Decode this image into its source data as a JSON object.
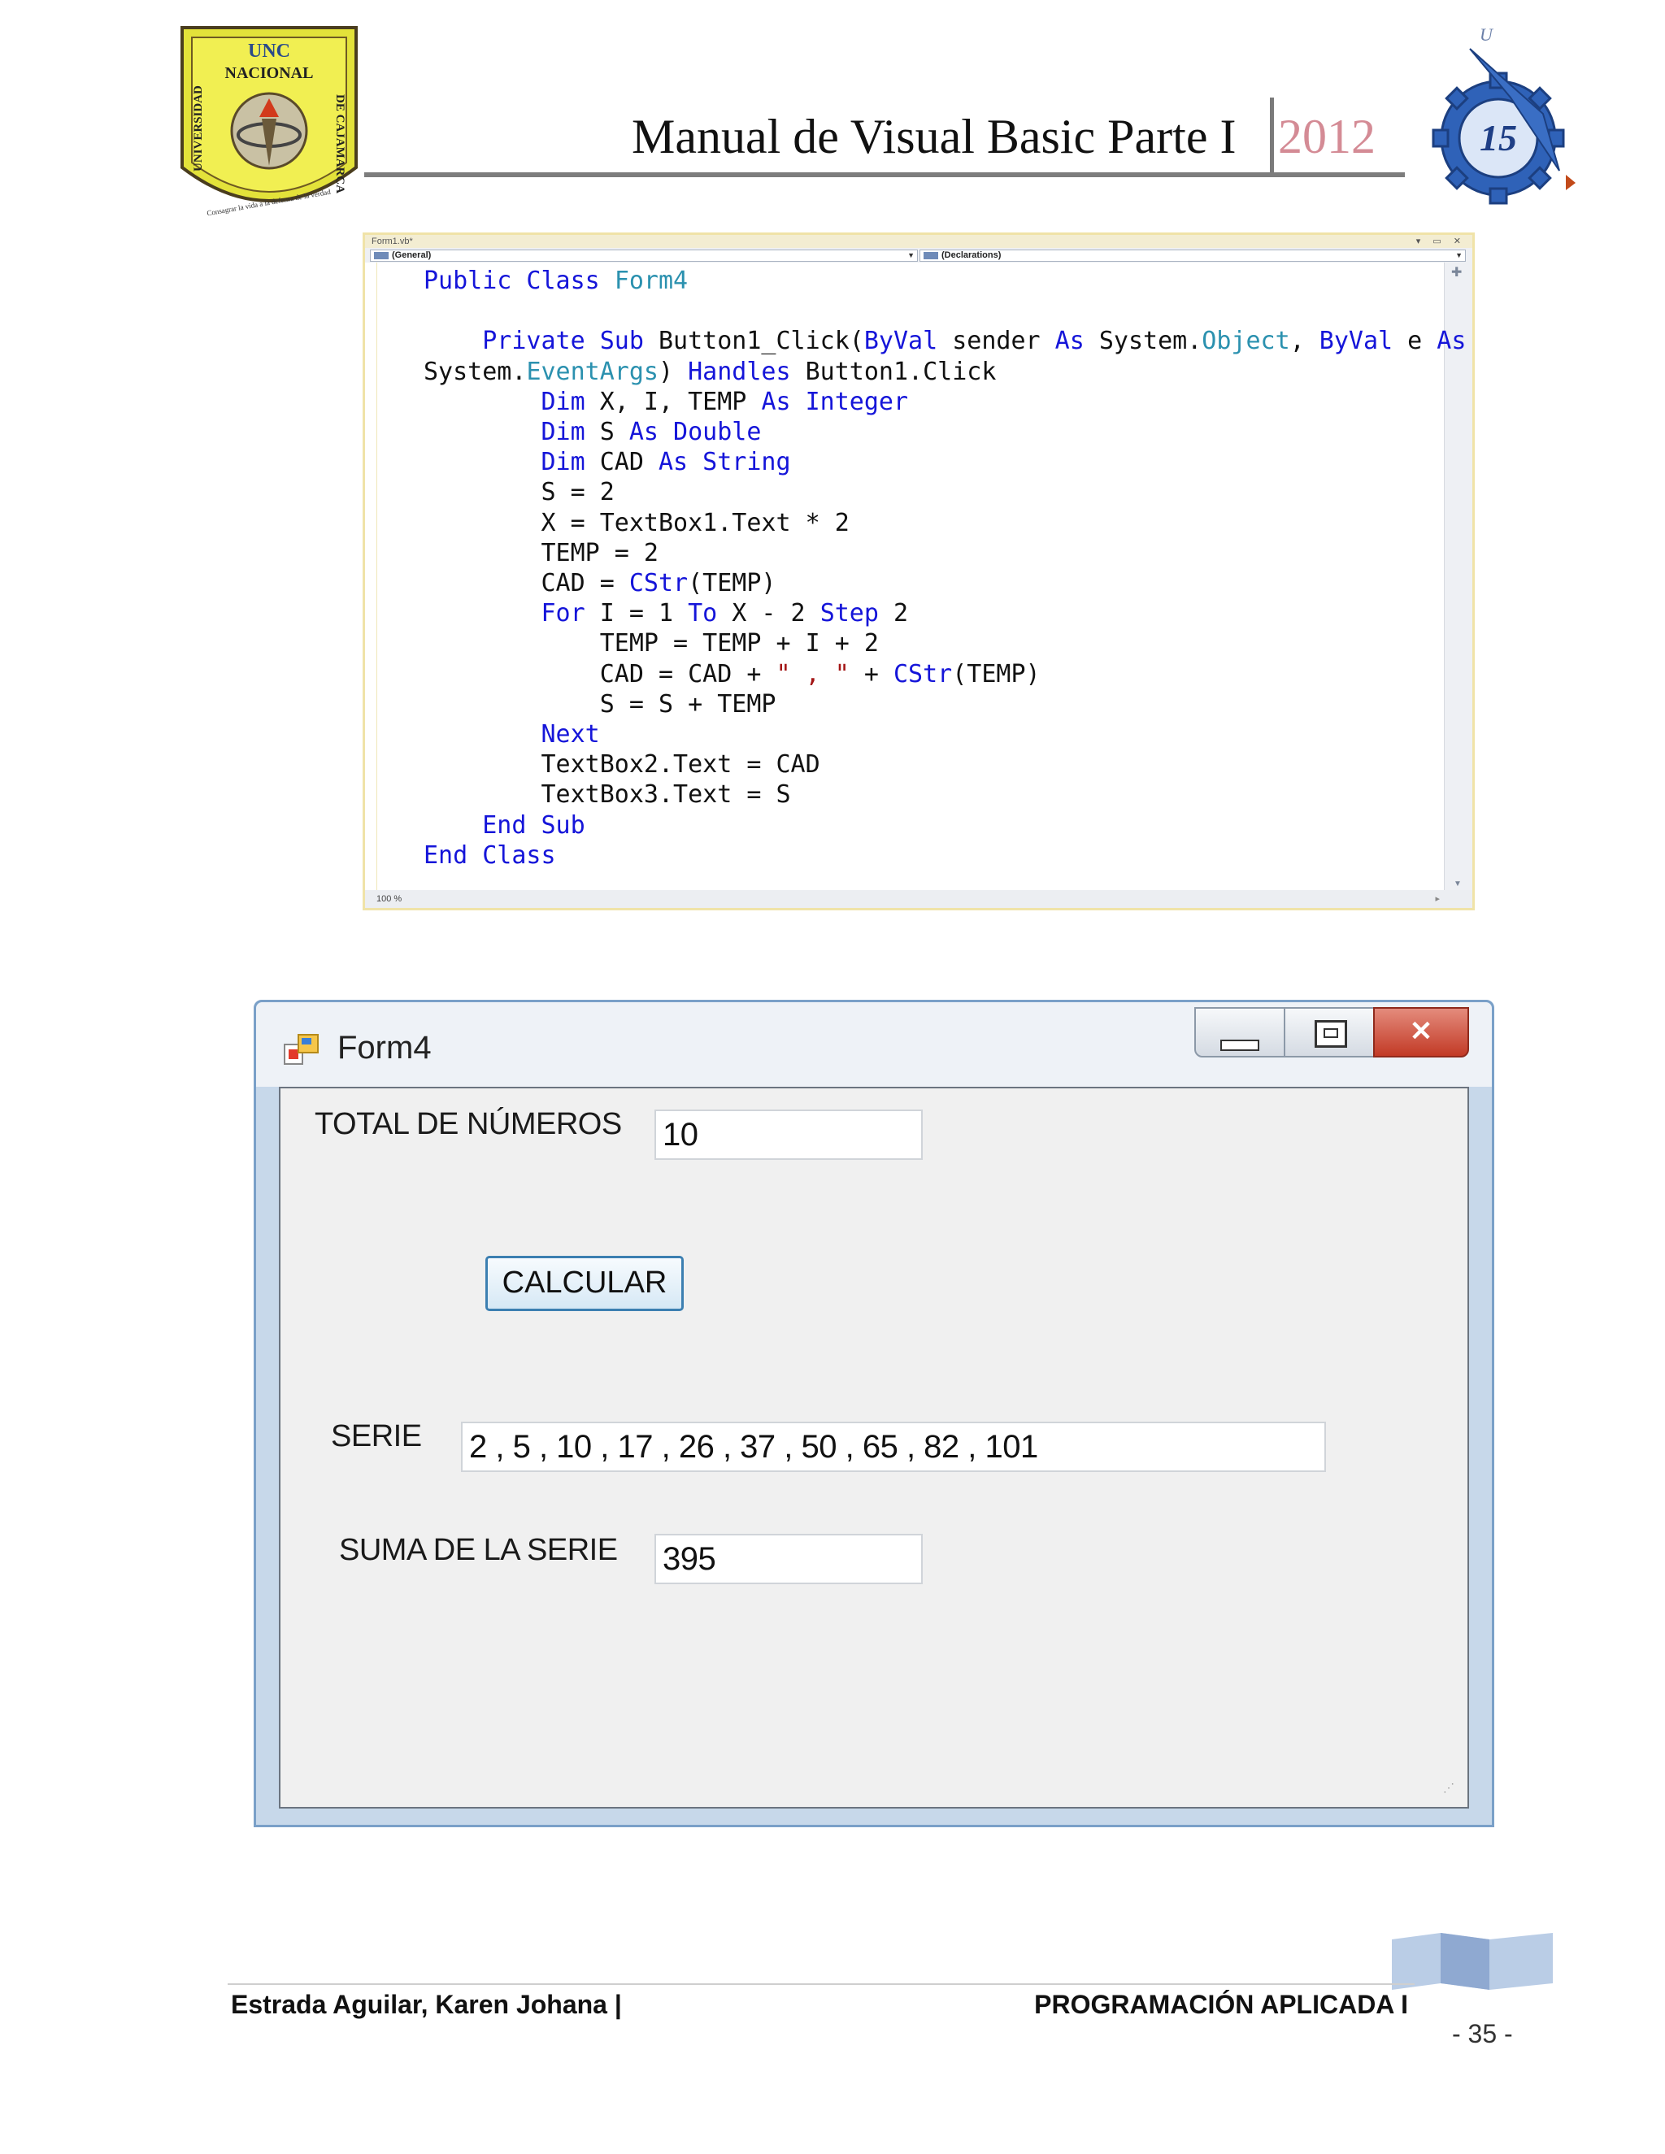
{
  "header": {
    "title": "Manual de Visual Basic Parte I",
    "year": "2012",
    "logo_left": {
      "acronym": "UNC",
      "top_text": "NACIONAL",
      "left_text": "UNIVERSIDAD",
      "right_text": "DE CAJAMARCA",
      "motto": "Consagrar la vida a la defensa de la verdad"
    },
    "logo_right": {
      "numeral": "15"
    }
  },
  "editor": {
    "file_tab": "Form1.vb*",
    "object_combo": "(General)",
    "member_combo": "(Declarations)",
    "zoom": "100 %",
    "code_lines": [
      [
        {
          "t": "Public Class ",
          "c": "kw"
        },
        {
          "t": "Form4",
          "c": "ty"
        }
      ],
      [],
      [
        {
          "t": "    Private Sub ",
          "c": "kw"
        },
        {
          "t": "Button1_Click(",
          "c": ""
        },
        {
          "t": "ByVal",
          "c": "kw"
        },
        {
          "t": " sender ",
          "c": ""
        },
        {
          "t": "As",
          "c": "kw"
        },
        {
          "t": " System.",
          "c": ""
        },
        {
          "t": "Object",
          "c": "ty"
        },
        {
          "t": ", ",
          "c": ""
        },
        {
          "t": "ByVal",
          "c": "kw"
        },
        {
          "t": " e ",
          "c": ""
        },
        {
          "t": "As",
          "c": "kw"
        }
      ],
      [
        {
          "t": "System.",
          "c": ""
        },
        {
          "t": "EventArgs",
          "c": "ty"
        },
        {
          "t": ") ",
          "c": ""
        },
        {
          "t": "Handles",
          "c": "kw"
        },
        {
          "t": " Button1.Click",
          "c": ""
        }
      ],
      [
        {
          "t": "        Dim",
          "c": "kw"
        },
        {
          "t": " X, I, TEMP ",
          "c": ""
        },
        {
          "t": "As Integer",
          "c": "kw"
        }
      ],
      [
        {
          "t": "        Dim",
          "c": "kw"
        },
        {
          "t": " S ",
          "c": ""
        },
        {
          "t": "As Double",
          "c": "kw"
        }
      ],
      [
        {
          "t": "        Dim",
          "c": "kw"
        },
        {
          "t": " CAD ",
          "c": ""
        },
        {
          "t": "As String",
          "c": "kw"
        }
      ],
      [
        {
          "t": "        S = 2",
          "c": ""
        }
      ],
      [
        {
          "t": "        X = TextBox1.Text * 2",
          "c": ""
        }
      ],
      [
        {
          "t": "        TEMP = 2",
          "c": ""
        }
      ],
      [
        {
          "t": "        CAD = ",
          "c": ""
        },
        {
          "t": "CStr",
          "c": "kw"
        },
        {
          "t": "(TEMP)",
          "c": ""
        }
      ],
      [
        {
          "t": "        For",
          "c": "kw"
        },
        {
          "t": " I = 1 ",
          "c": ""
        },
        {
          "t": "To",
          "c": "kw"
        },
        {
          "t": " X - 2 ",
          "c": ""
        },
        {
          "t": "Step",
          "c": "kw"
        },
        {
          "t": " 2",
          "c": ""
        }
      ],
      [
        {
          "t": "            TEMP = TEMP + I + 2",
          "c": ""
        }
      ],
      [
        {
          "t": "            CAD = CAD + ",
          "c": ""
        },
        {
          "t": "\" , \"",
          "c": "st"
        },
        {
          "t": " + ",
          "c": ""
        },
        {
          "t": "CStr",
          "c": "kw"
        },
        {
          "t": "(TEMP)",
          "c": ""
        }
      ],
      [
        {
          "t": "            S = S + TEMP",
          "c": ""
        }
      ],
      [
        {
          "t": "        Next",
          "c": "kw"
        }
      ],
      [
        {
          "t": "        TextBox2.Text = CAD",
          "c": ""
        }
      ],
      [
        {
          "t": "        TextBox3.Text = S",
          "c": ""
        }
      ],
      [
        {
          "t": "    End Sub",
          "c": "kw"
        }
      ],
      [
        {
          "t": "End Class",
          "c": "kw"
        }
      ]
    ]
  },
  "form": {
    "title": "Form4",
    "total_label": "TOTAL DE NÚMEROS",
    "total_value": "10",
    "calculate_button": "CALCULAR",
    "serie_label": "SERIE",
    "serie_value": "2 , 5 , 10 , 17 , 26 , 37 , 50 , 65 , 82 , 101",
    "suma_label": "SUMA DE LA SERIE",
    "suma_value": "395"
  },
  "footer": {
    "author": "Estrada Aguilar, Karen Johana |",
    "course": "PROGRAMACIÓN APLICADA I",
    "page": "- 35 -"
  },
  "colors": {
    "keyword": "#1515d9",
    "type": "#2b91af",
    "string": "#a31515",
    "year": "#d48b95"
  }
}
